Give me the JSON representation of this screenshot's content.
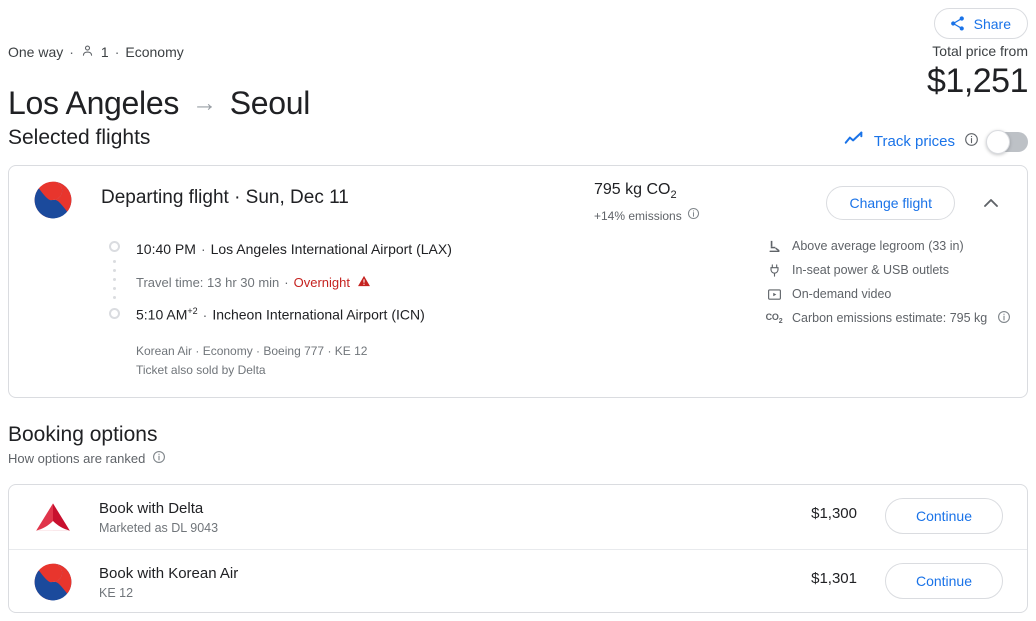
{
  "header": {
    "share_label": "Share",
    "share_icon": "share-icon",
    "trip_type": "One way",
    "separator": "·",
    "passengers": "1",
    "passenger_icon": "person-icon",
    "cabin_class": "Economy",
    "origin": "Los Angeles",
    "arrow": "→",
    "destination": "Seoul",
    "total_price_label": "Total price from",
    "total_price": "$1,251"
  },
  "selected_flights": {
    "heading": "Selected flights",
    "track_prices_label": "Track prices",
    "track_prices_icon": "trend-line-icon",
    "track_prices_info_icon": "info-icon",
    "toggle_state": "off"
  },
  "flight_card": {
    "airline_logo_icon": "korean-air-logo",
    "title": "Departing flight · Sun, Dec 11",
    "co2_value": "795 kg CO",
    "co2_subscript": "2",
    "emissions_delta": "+14% emissions",
    "emissions_info_icon": "info-icon",
    "change_flight_label": "Change flight",
    "collapse_icon": "chevron-up-icon",
    "departure": {
      "time": "10:40 PM",
      "separator": "·",
      "airport": "Los Angeles International Airport (LAX)"
    },
    "travel_time": "Travel time: 13 hr 30 min",
    "travel_sep": "·",
    "overnight_label": "Overnight",
    "overnight_icon": "warning-triangle-icon",
    "arrival": {
      "time": "5:10 AM",
      "day_offset": "+2",
      "separator": "·",
      "airport": "Incheon International Airport (ICN)"
    },
    "details_line_1": "Korean Air · Economy · Boeing 777 · KE 12",
    "details_line_2": "Ticket also sold by Delta",
    "amenities": [
      {
        "icon": "legroom-icon",
        "label": "Above average legroom (33 in)"
      },
      {
        "icon": "power-plug-icon",
        "label": "In-seat power & USB outlets"
      },
      {
        "icon": "video-player-icon",
        "label": "On-demand video"
      },
      {
        "icon": "co2-icon",
        "label": "Carbon emissions estimate: 795 kg",
        "info_icon": "info-icon"
      }
    ]
  },
  "booking_options": {
    "heading": "Booking options",
    "ranked_label": "How options are ranked",
    "ranked_info_icon": "info-icon",
    "rows": [
      {
        "logo_icon": "delta-logo",
        "name": "Book with Delta",
        "meta": "Marketed as DL 9043",
        "price": "$1,300",
        "cta_label": "Continue"
      },
      {
        "logo_icon": "korean-air-logo",
        "name": "Book with Korean Air",
        "meta": "KE 12",
        "price": "$1,301",
        "cta_label": "Continue"
      }
    ]
  },
  "colors": {
    "accent_blue": "#1a73e8",
    "text_primary": "#202124",
    "text_secondary": "#5f6368",
    "border": "#dadce0",
    "warning_red": "#c5221f",
    "korean_air_red": "#e8352d",
    "korean_air_blue": "#1b4a9c",
    "delta_red": "#c8102e"
  }
}
